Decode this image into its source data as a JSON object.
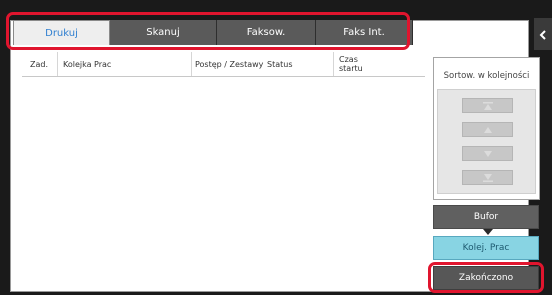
{
  "tabs": [
    {
      "label": "Drukuj",
      "active": true
    },
    {
      "label": "Skanuj",
      "active": false
    },
    {
      "label": "Faksow.",
      "active": false
    },
    {
      "label": "Faks Int.",
      "active": false
    }
  ],
  "table": {
    "columns": [
      "Zad.",
      "Kolejka Prac",
      "Postęp / Zestawy",
      "Status",
      "Czas startu"
    ],
    "rows": []
  },
  "sort": {
    "title": "Sortow. w kolejności"
  },
  "buttons": {
    "bufor": "Bufor",
    "kolej_prac": "Kolej. Prac",
    "zakonczono": "Zakończono"
  },
  "colors": {
    "active_tab_text": "#2f7fd0",
    "highlight": "#e0152e",
    "kolej_prac_bg": "#88d4e3"
  },
  "icons": {
    "side_tab": "chevron-left-icon",
    "sort_1": "move-to-top-icon",
    "sort_2": "move-up-icon",
    "sort_3": "move-down-icon",
    "sort_4": "move-to-bottom-icon"
  }
}
